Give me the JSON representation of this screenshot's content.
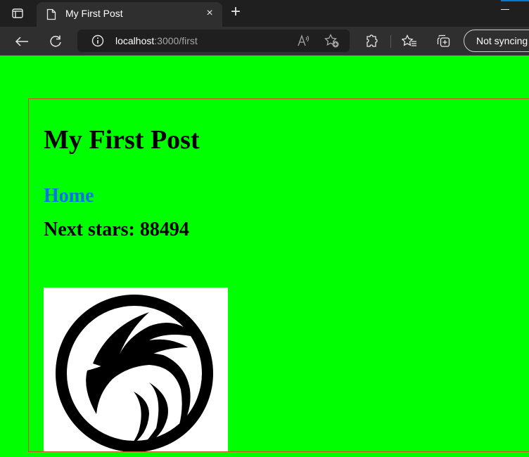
{
  "browser": {
    "tab": {
      "title": "My First Post",
      "icon": "page-icon",
      "close_label": "×"
    },
    "new_tab_label": "+",
    "address": {
      "host": "localhost",
      "path": ":3000/first",
      "info_icon": "info-icon"
    },
    "toolbar_icons": [
      "back-icon",
      "refresh-icon",
      "read-aloud-icon",
      "add-favorite-icon",
      "extensions-icon",
      "favorites-icon",
      "collections-icon"
    ],
    "sync_label": "Not syncing"
  },
  "page": {
    "background_color": "#00ff00",
    "border_color": "#c8541e",
    "title": "My First Post",
    "home_link": "Home",
    "link_color": "#0070f3",
    "stars_text": "Next stars: 88494",
    "image_alt": "eagle-logo"
  }
}
